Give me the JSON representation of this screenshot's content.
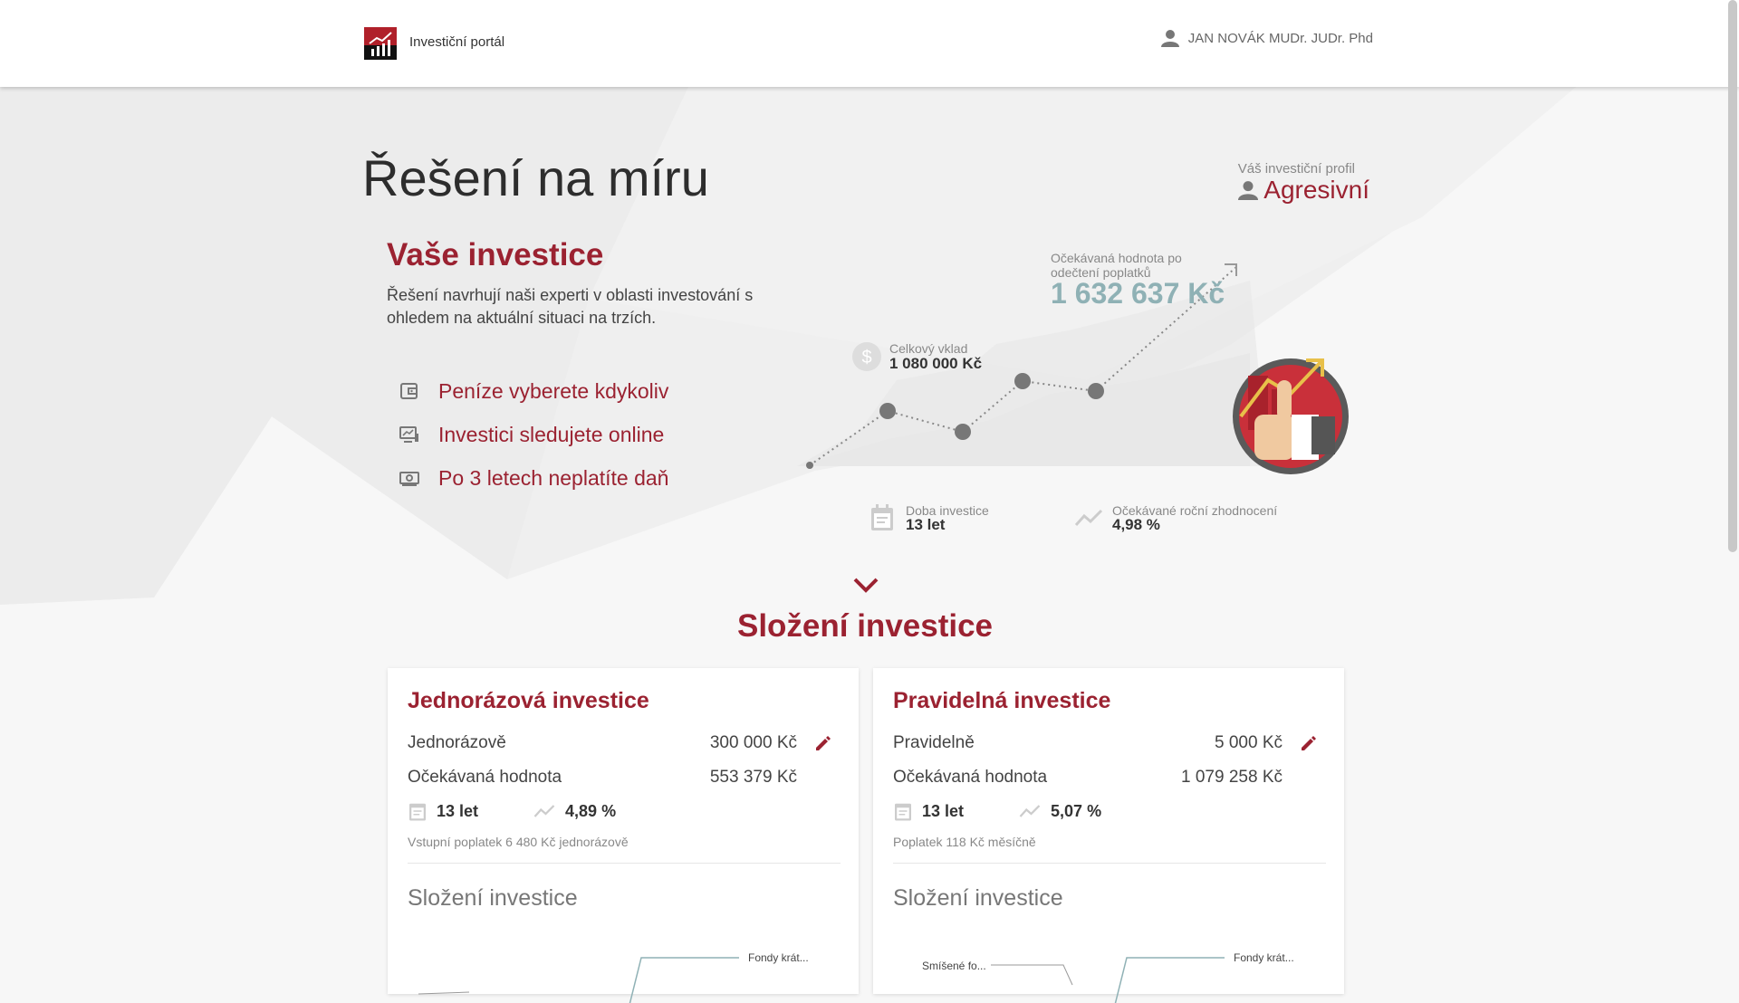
{
  "header": {
    "brand": "Investiční portál",
    "user_name": "JAN NOVÁK MUDr. JUDr. Phd"
  },
  "page": {
    "title": "Řešení na míru",
    "profile_label": "Váš investiční profil",
    "profile_value": "Agresivní"
  },
  "intro": {
    "title": "Vaše investice",
    "description": "Řešení navrhují naši experti v oblasti investování s ohledem na aktuální situaci na trzích.",
    "benefits": [
      {
        "icon": "wallet-icon",
        "label": "Peníze vyberete kdykoliv"
      },
      {
        "icon": "monitor-chart-icon",
        "label": "Investici sledujete online"
      },
      {
        "icon": "cash-icon",
        "label": "Po 3 letech neplatíte daň"
      }
    ]
  },
  "summary": {
    "expected_label": "Očekávaná hodnota po odečtení poplatků",
    "expected_value": "1 632 637 Kč",
    "deposit_label": "Celkový vklad",
    "deposit_value": "1 080 000 Kč",
    "duration_label": "Doba investice",
    "duration_value": "13 let",
    "yield_label": "Očekávané roční zhodnocení",
    "yield_value": "4,98 %"
  },
  "composition": {
    "section_title": "Složení investice",
    "cards": [
      {
        "title": "Jednorázová investice",
        "amount_label": "Jednorázově",
        "amount_value": "300 000 Kč",
        "expected_label": "Očekávaná hodnota",
        "expected_value": "553 379 Kč",
        "duration": "13 let",
        "yield": "4,89 %",
        "fee": "Vstupní poplatek 6 480 Kč jednorázově",
        "composition_title": "Složení investice",
        "chart_labels": [
          "Fondy krát..."
        ]
      },
      {
        "title": "Pravidelná investice",
        "amount_label": "Pravidelně",
        "amount_value": "5 000 Kč",
        "expected_label": "Očekávaná hodnota",
        "expected_value": "1 079 258 Kč",
        "duration": "13 let",
        "yield": "5,07 %",
        "fee": "Poplatek 118 Kč měsíčně",
        "composition_title": "Složení investice",
        "chart_labels": [
          "Smíšené fo...",
          "Fondy krát..."
        ]
      }
    ]
  },
  "colors": {
    "accent": "#9b2231",
    "teal": "#8fb1b5",
    "background": "#f7f7f7"
  }
}
